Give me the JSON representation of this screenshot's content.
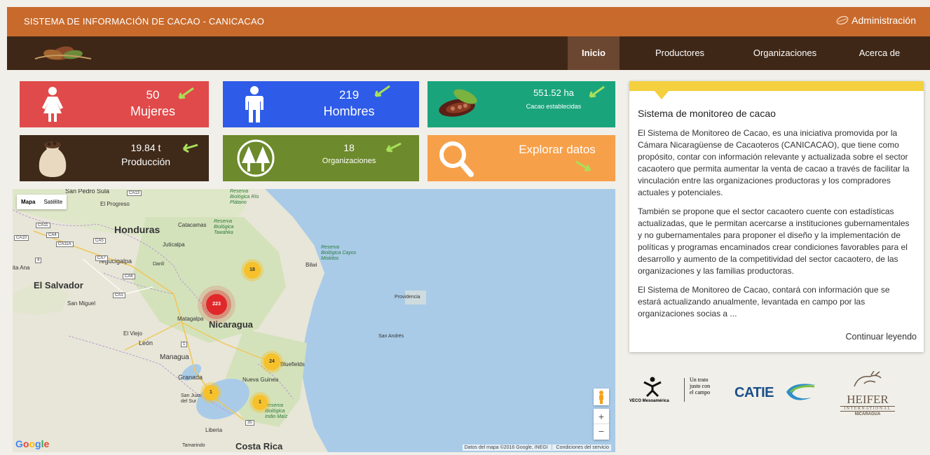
{
  "header": {
    "title": "SISTEMA DE INFORMACIÓN DE CACAO - CANICACAO",
    "admin_label": "Administración"
  },
  "nav": {
    "items": [
      {
        "label": "Inicio",
        "active": true
      },
      {
        "label": "Productores"
      },
      {
        "label": "Organizaciones"
      },
      {
        "label": "Acerca de"
      }
    ]
  },
  "stats": {
    "mujeres": {
      "value": "50",
      "label": "Mujeres"
    },
    "hombres": {
      "value": "219",
      "label": "Hombres"
    },
    "cacao": {
      "value": "551.52 ha",
      "label": "Cacao establecidas"
    },
    "produccion": {
      "value": "19.84 t",
      "label": "Producción"
    },
    "organizaciones": {
      "value": "18",
      "label": "Organizaciones"
    },
    "explorar": {
      "label": "Explorar datos"
    }
  },
  "colors": {
    "mujeres": "#e04a4a",
    "hombres": "#2e5be8",
    "cacao": "#1aa47c",
    "produccion": "#3f2a1a",
    "organizaciones": "#6d8a2c",
    "explorar": "#f7a04a",
    "arrow": "#a8e05a"
  },
  "map": {
    "type_options": [
      "Mapa",
      "Satélite"
    ],
    "labels": {
      "san_pedro": "San Pedro Sula",
      "el_progreso": "El Progreso",
      "honduras": "Honduras",
      "catacamas": "Catacamas",
      "juticalpa": "Juticalpa",
      "tegucigalpa": "Tegucigalpa",
      "danli": "Danlí",
      "ita_ana": "ita Ana",
      "el_salvador": "El Salvador",
      "san_miguel": "San Miguel",
      "nicaragua": "Nicaragua",
      "matagalpa": "Matagalpa",
      "el_viejo": "El Viejo",
      "leon": "León",
      "managua": "Managua",
      "granada": "Granada",
      "san_juan": "San Juan del Sur",
      "nueva_guinea": "Nueva Guinea",
      "bluefields": "Bluefields",
      "bilwi": "Bilwi",
      "providencia": "Providencia",
      "san_andres": "San Andrés",
      "liberia": "Liberia",
      "costa_rica": "Costa Rica",
      "tamarindo": "Tamarindo",
      "reserva_platano": "Reserva Biológica Río Plátano",
      "reserva_tawahka": "Reserva Biológica Tawahka",
      "reserva_miskitos": "Reserva Biológica Cayos Miskitos",
      "reserva_maiz": "Reserva Biológica Indio Maíz",
      "ca13": "CA13",
      "ca11": "CA11",
      "ca4": "CA4",
      "ca10": "CA10",
      "ca11a": "CA11A",
      "ca5": "CA5",
      "ca7": "CA7",
      "ca6": "CA6",
      "ca1": "CA1",
      "r4": "4",
      "r1": "1",
      "r35": "35"
    },
    "clusters": [
      "18",
      "223",
      "24",
      "1",
      "1"
    ],
    "attribution": "Datos del mapa ©2016 Google, INEGI",
    "terms": "Condiciones del servicio",
    "google": "Google",
    "zoom_in": "+",
    "zoom_out": "−"
  },
  "card": {
    "title": "Sistema de monitoreo de cacao",
    "paragraphs": [
      "El Sistema de Monitoreo de Cacao, es una iniciativa promovida por la Cámara Nicaragüense de Cacaoteros (CANICACAO), que tiene como propósito, contar con información relevante y actualizada sobre el sector cacaotero que permita aumentar la venta de cacao a través de facilitar la vinculación entre las organizaciones productoras y los compradores actuales y potenciales.",
      "También se propone que el sector cacaotero cuente con estadísticas actualizadas, que le permitan acercarse a instituciones gubernamentales y no gubernamentales para proponer el diseño y la implementación de políticas y programas encaminados crear condiciones favorables para el desarrollo y aumento de la competitividad del sector cacaotero, de las organizaciones y las familias productoras.",
      "El Sistema de Monitoreo de Cacao, contará con información que se estará actualizando anualmente, levantada en campo por las organizaciones socias a ..."
    ],
    "more": "Continuar leyendo"
  },
  "partners": {
    "veco": {
      "name": "VECO Mesoamérica",
      "tag1": "Un trato",
      "tag2": "justo con",
      "tag3": "el campo"
    },
    "catie": {
      "name": "CATIE"
    },
    "heifer": {
      "name": "HEIFER",
      "sub": "INTERNATIONAL",
      "country": "NICARAGUA"
    }
  }
}
